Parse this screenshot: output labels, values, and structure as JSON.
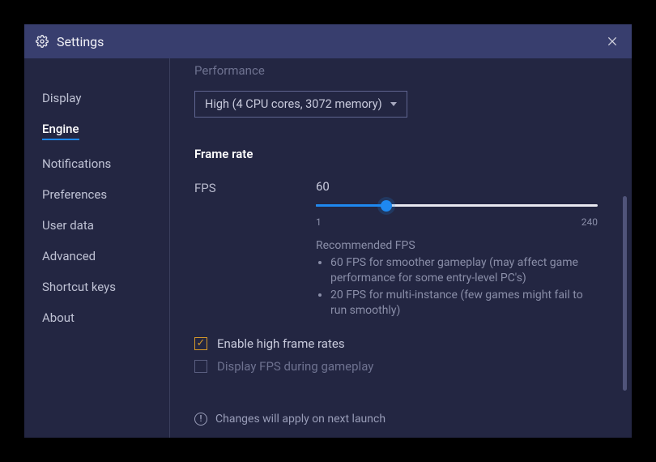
{
  "titlebar": {
    "title": "Settings"
  },
  "sidebar": {
    "items": [
      {
        "label": "Display"
      },
      {
        "label": "Engine"
      },
      {
        "label": "Notifications"
      },
      {
        "label": "Preferences"
      },
      {
        "label": "User data"
      },
      {
        "label": "Advanced"
      },
      {
        "label": "Shortcut keys"
      },
      {
        "label": "About"
      }
    ],
    "active_index": 1
  },
  "content": {
    "performance": {
      "label": "Performance",
      "selected": "High (4 CPU cores, 3072 memory)"
    },
    "frame_rate": {
      "title": "Frame rate",
      "fps_label": "FPS",
      "fps_value": "60",
      "min": "1",
      "max": "240",
      "recommended_title": "Recommended FPS",
      "recommendations": [
        "60 FPS for smoother gameplay (may affect game performance for some entry-level PC's)",
        "20 FPS for multi-instance (few games might fail to run smoothly)"
      ]
    },
    "checkboxes": {
      "enable_high_fps": {
        "label": "Enable high frame rates",
        "checked": true
      },
      "display_fps": {
        "label": "Display FPS during gameplay",
        "checked": false
      }
    },
    "notice": "Changes will apply on next launch"
  }
}
